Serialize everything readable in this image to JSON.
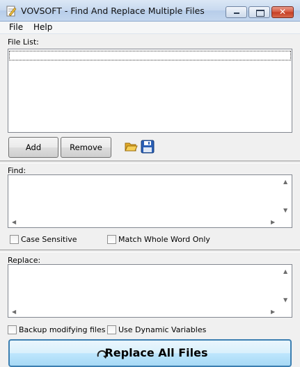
{
  "window": {
    "title": "VOVSOFT - Find And Replace Multiple Files",
    "close_glyph": "✕"
  },
  "menu": {
    "items": [
      "File",
      "Help"
    ]
  },
  "file_list": {
    "label": "File List:",
    "add_label": "Add",
    "remove_label": "Remove",
    "open_icon": "folder-open-icon",
    "save_icon": "save-icon"
  },
  "find": {
    "label": "Find:",
    "value": "",
    "case_sensitive_label": "Case Sensitive",
    "case_sensitive_checked": false,
    "whole_word_label": "Match Whole Word Only",
    "whole_word_checked": false
  },
  "replace": {
    "label": "Replace:",
    "value": "",
    "backup_label": "Backup modifying files",
    "backup_checked": false,
    "dynamic_label": "Use Dynamic Variables",
    "dynamic_checked": false
  },
  "action": {
    "replace_all_label": "Replace All Files"
  },
  "arrows": {
    "up": "▲",
    "down": "▼",
    "left": "◀",
    "right": "▶"
  }
}
